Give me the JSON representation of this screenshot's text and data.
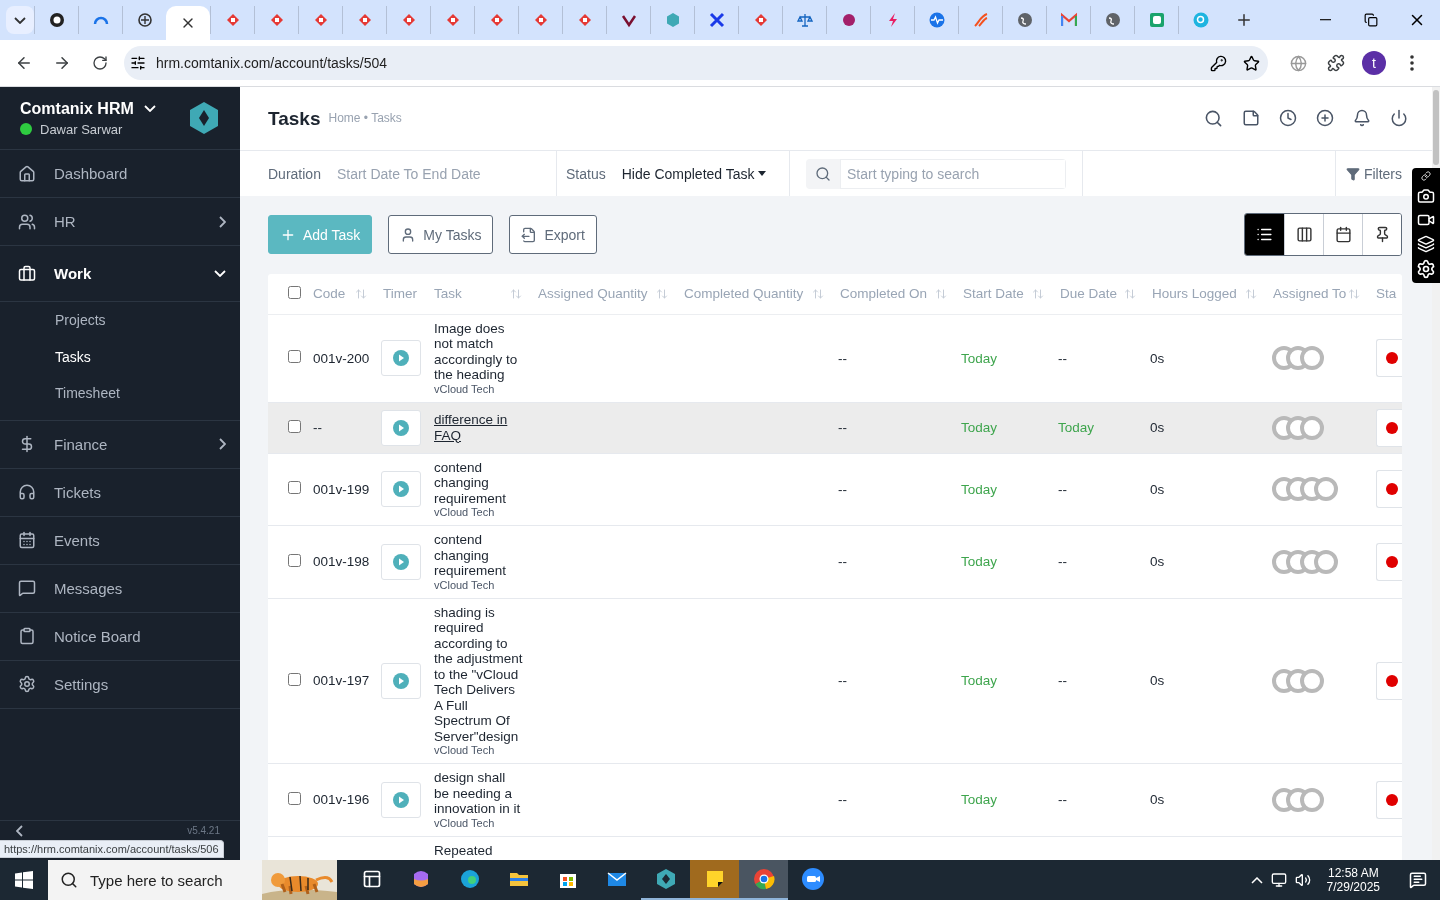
{
  "browser": {
    "tabs": [
      {
        "selected": false
      },
      {
        "selected": false
      },
      {
        "selected": false
      },
      {
        "selected": true
      },
      {
        "selected": false
      },
      {
        "selected": false
      },
      {
        "selected": false
      },
      {
        "selected": false
      },
      {
        "selected": false
      },
      {
        "selected": false
      },
      {
        "selected": false
      },
      {
        "selected": false
      },
      {
        "selected": false
      },
      {
        "selected": false
      },
      {
        "selected": false
      },
      {
        "selected": false
      },
      {
        "selected": false
      },
      {
        "selected": false
      },
      {
        "selected": false
      },
      {
        "selected": false
      },
      {
        "selected": false
      },
      {
        "selected": false
      },
      {
        "selected": false
      },
      {
        "selected": false
      },
      {
        "selected": false
      },
      {
        "selected": false
      },
      {
        "selected": false
      }
    ],
    "url": "hrm.comtanix.com/account/tasks/504",
    "profile_initial": "t",
    "status_url": "https://hrm.comtanix.com/account/tasks/506"
  },
  "sidebar": {
    "brand": "Comtanix HRM",
    "user": "Dawar Sarwar",
    "online": true,
    "items": [
      {
        "label": "Dashboard",
        "selected": false
      },
      {
        "label": "HR",
        "selected": false,
        "expanded": false
      },
      {
        "label": "Work",
        "selected": true,
        "expanded": true,
        "children": [
          {
            "label": "Projects",
            "selected": false
          },
          {
            "label": "Tasks",
            "selected": true
          },
          {
            "label": "Timesheet",
            "selected": false
          }
        ]
      },
      {
        "label": "Finance",
        "selected": false,
        "expanded": false
      },
      {
        "label": "Tickets",
        "selected": false
      },
      {
        "label": "Events",
        "selected": false
      },
      {
        "label": "Messages",
        "selected": false
      },
      {
        "label": "Notice Board",
        "selected": false
      },
      {
        "label": "Settings",
        "selected": false
      }
    ],
    "version": "v5.4.21"
  },
  "header": {
    "title": "Tasks",
    "breadcrumb": "Home • Tasks"
  },
  "filters": {
    "duration_label": "Duration",
    "duration_placeholder": "Start Date To End Date",
    "status_label": "Status",
    "status_value": "Hide Completed Task",
    "search": {
      "placeholder": "Start typing to search"
    },
    "filters_button": "Filters"
  },
  "actions": [
    "Add Task",
    "My Tasks",
    "Export"
  ],
  "views": [
    {
      "selected": true
    },
    {
      "selected": false
    },
    {
      "selected": false
    },
    {
      "selected": false
    }
  ],
  "table": {
    "select_all": {
      "checked": false
    },
    "columns": [
      {
        "label": "Code",
        "sortable": true
      },
      {
        "label": "Timer",
        "sortable": false
      },
      {
        "label": "Task",
        "sortable": true
      },
      {
        "label": "Assigned Quantity",
        "sortable": true
      },
      {
        "label": "Completed Quantity",
        "sortable": true
      },
      {
        "label": "Completed On",
        "sortable": true
      },
      {
        "label": "Start Date",
        "sortable": true
      },
      {
        "label": "Due Date",
        "sortable": true
      },
      {
        "label": "Hours Logged",
        "sortable": true
      },
      {
        "label": "Assigned To",
        "sortable": true
      },
      {
        "label": "Sta"
      }
    ],
    "rows": [
      {
        "checked": false,
        "hovered": false,
        "code": "001v-200",
        "task": "Image does not match accordingly to the heading",
        "project": "vCloud Tech",
        "completed_on": "--",
        "start_date": {
          "text": "Today",
          "color": "#3ea54d"
        },
        "due_date": {
          "text": "--"
        },
        "hours": "0s",
        "assignees": [
          {
            "kind": "avatar"
          },
          {
            "kind": "avatar"
          },
          {
            "kind": "avatar"
          }
        ],
        "status": {
          "color": "#e00000"
        }
      },
      {
        "checked": false,
        "hovered": true,
        "code": "--",
        "task": "difference in FAQ",
        "completed_on": "--",
        "start_date": {
          "text": "Today",
          "color": "#3ea54d"
        },
        "due_date": {
          "text": "Today",
          "color": "#3ea54d"
        },
        "hours": "0s",
        "assignees": [
          {
            "kind": "avatar"
          },
          {
            "kind": "avatar"
          },
          {
            "kind": "avatar"
          }
        ],
        "status": {
          "color": "#e00000"
        }
      },
      {
        "checked": false,
        "hovered": false,
        "code": "001v-199",
        "task": "contend changing requirement",
        "project": "vCloud Tech",
        "completed_on": "--",
        "start_date": {
          "text": "Today",
          "color": "#3ea54d"
        },
        "due_date": {
          "text": "--"
        },
        "hours": "0s",
        "assignees": [
          {
            "kind": "avatar"
          },
          {
            "kind": "avatar"
          },
          {
            "kind": "avatar"
          },
          {
            "kind": "avatar"
          }
        ],
        "status": {
          "color": "#e00000"
        }
      },
      {
        "checked": false,
        "hovered": false,
        "code": "001v-198",
        "task": "contend changing requirement",
        "project": "vCloud Tech",
        "completed_on": "--",
        "start_date": {
          "text": "Today",
          "color": "#3ea54d"
        },
        "due_date": {
          "text": "--"
        },
        "hours": "0s",
        "assignees": [
          {
            "kind": "avatar"
          },
          {
            "kind": "avatar"
          },
          {
            "kind": "avatar"
          },
          {
            "kind": "avatar"
          }
        ],
        "status": {
          "color": "#e00000"
        }
      },
      {
        "checked": false,
        "hovered": false,
        "code": "001v-197",
        "task": "shading is required according to the adjustment to the \"vCloud Tech Delivers A Full Spectrum Of Server\"design",
        "project": "vCloud Tech",
        "completed_on": "--",
        "start_date": {
          "text": "Today",
          "color": "#3ea54d"
        },
        "due_date": {
          "text": "--"
        },
        "hours": "0s",
        "assignees": [
          {
            "kind": "avatar"
          },
          {
            "kind": "avatar"
          },
          {
            "kind": "avatar"
          }
        ],
        "status": {
          "color": "#e00000"
        }
      },
      {
        "checked": false,
        "hovered": false,
        "code": "001v-196",
        "task": "design shall be needing a innovation in it",
        "project": "vCloud Tech",
        "completed_on": "--",
        "start_date": {
          "text": "Today",
          "color": "#3ea54d"
        },
        "due_date": {
          "text": "--"
        },
        "hours": "0s",
        "assignees": [
          {
            "kind": "avatar"
          },
          {
            "kind": "avatar"
          },
          {
            "kind": "avatar"
          }
        ],
        "status": {
          "color": "#e00000"
        }
      },
      {
        "hovered": false,
        "task": "Repeated"
      }
    ]
  },
  "taskbar": {
    "search": {
      "placeholder": "Type here to search"
    },
    "apps": [
      {
        "running": false
      },
      {
        "running": false
      },
      {
        "running": false
      },
      {
        "running": false
      },
      {
        "running": false
      },
      {
        "running": false
      },
      {
        "running": true
      },
      {
        "running": true
      },
      {
        "running": true
      },
      {
        "running": false
      }
    ],
    "time": "12:58 AM",
    "date": "7/29/2025"
  }
}
